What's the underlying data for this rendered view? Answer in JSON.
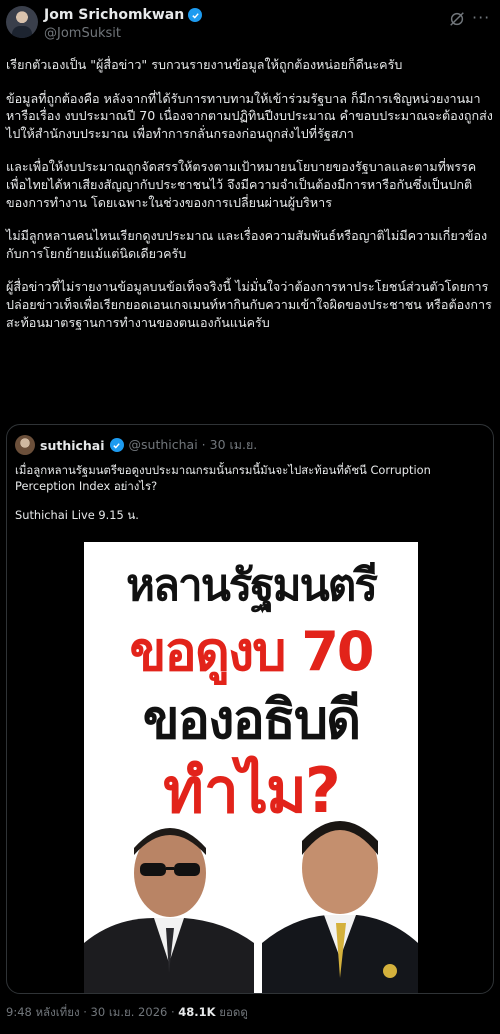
{
  "author": {
    "name": "Jom Srichomkwan",
    "handle": "@JomSuksit"
  },
  "post": {
    "paragraphs": [
      "เรียกตัวเองเป็น \"ผู้สื่อข่าว\" รบกวนรายงานข้อมูลให้ถูกต้องหน่อยก็ดีนะครับ",
      "ข้อมูลที่ถูกต้องคือ หลังจากที่ได้รับการทาบทามให้เข้าร่วมรัฐบาล ก็มีการเชิญหน่วยงานมาหารือเรื่อง งบประมาณปี 70 เนื่องจากตามปฏิทินปีงบประมาณ คำขอบประมาณจะต้องถูกส่งไปให้สำนักงบประมาณ เพื่อทำการกลั่นกรองก่อนถูกส่งไปที่รัฐสภา",
      "และเพื่อให้งบประมาณถูกจัดสรรให้ตรงตามเป้าหมายนโยบายของรัฐบาลและตามที่พรรคเพื่อไทยได้หาเสียงสัญญากับประชาชนไว้ จึงมีความจำเป็นต้องมีการหารือกันซึ่งเป็นปกติของการทำงาน โดยเฉพาะในช่วงของการเปลี่ยนผ่านผู้บริหาร",
      "ไม่มีลูกหลานคนไหนเรียกดูงบประมาณ และเรื่องความสัมพันธ์หรือญาติไม่มีความเกี่ยวข้องกับการโยกย้ายแม้แต่นิดเดียวครับ",
      "ผู้สื่อข่าวที่ไม่รายงานข้อมูลบนข้อเท็จจริงนี้ ไม่มั่นใจว่าต้องการหาประโยชน์ส่วนตัวโดยการปล่อยข่าวเท็จเพื่อเรียกยอดเอนเกจเมนท์หากินกับความเข้าใจผิดของประชาชน หรือต้องการสะท้อนมาตรฐานการทำงานของตนเองกันแน่ครับ"
    ],
    "timestamp": "9:48 หลังเที่ยง · 30 เม.ย. 2026 ·",
    "views_count": "48.1K",
    "views_label": " ยอดดู"
  },
  "quote": {
    "name": "suthichai",
    "handle": "@suthichai · 30 เม.ย.",
    "paragraphs": [
      "เมื่อลูกหลานรัฐมนตรีขอดูงบประมาณกรมนั้นกรมนี้มันจะไปสะท้อนที่ดัชนี Corruption Perception Index อย่างไร?",
      "Suthichai Live 9.15 น."
    ],
    "poster_lines": [
      "หลานรัฐมนตรี",
      "ขอดูงบ 70",
      "ของอธิบดี",
      "ทำไม?"
    ]
  },
  "colors": {
    "verified": "#1d9bf0",
    "poster_red": "#e2231a",
    "muted": "#71767b"
  }
}
